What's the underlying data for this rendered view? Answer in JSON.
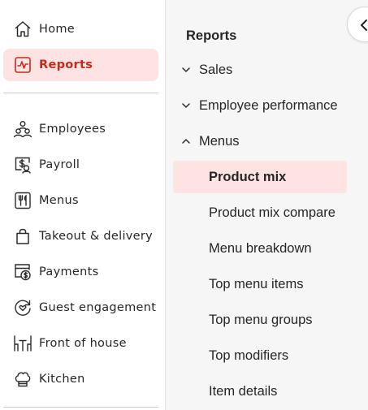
{
  "nav": {
    "items": [
      {
        "label": "Home",
        "icon": "home-icon"
      },
      {
        "label": "Reports",
        "icon": "pulse-chart-icon",
        "active": true
      },
      {
        "label": "Employees",
        "icon": "users-icon"
      },
      {
        "label": "Payroll",
        "icon": "payroll-dollar-icon"
      },
      {
        "label": "Menus",
        "icon": "fork-knife-icon"
      },
      {
        "label": "Takeout & delivery",
        "icon": "shopping-bag-icon"
      },
      {
        "label": "Payments",
        "icon": "payments-icon"
      },
      {
        "label": "Guest engagement",
        "icon": "heart-cycle-icon"
      },
      {
        "label": "Front of house",
        "icon": "dining-table-icon"
      },
      {
        "label": "Kitchen",
        "icon": "chef-hat-icon"
      }
    ]
  },
  "reports": {
    "title": "Reports",
    "groups": [
      {
        "label": "Sales",
        "expanded": false
      },
      {
        "label": "Employee performance",
        "expanded": false
      },
      {
        "label": "Menus",
        "expanded": true
      }
    ],
    "menus_items": [
      {
        "label": "Product mix",
        "active": true
      },
      {
        "label": "Product mix compare"
      },
      {
        "label": "Menu breakdown"
      },
      {
        "label": "Top menu items"
      },
      {
        "label": "Top menu groups"
      },
      {
        "label": "Top modifiers"
      },
      {
        "label": "Item details"
      }
    ]
  },
  "colors": {
    "accent": "#c8291e",
    "active_bg": "#fde4e2",
    "panel_bg": "#f6f6f6"
  }
}
